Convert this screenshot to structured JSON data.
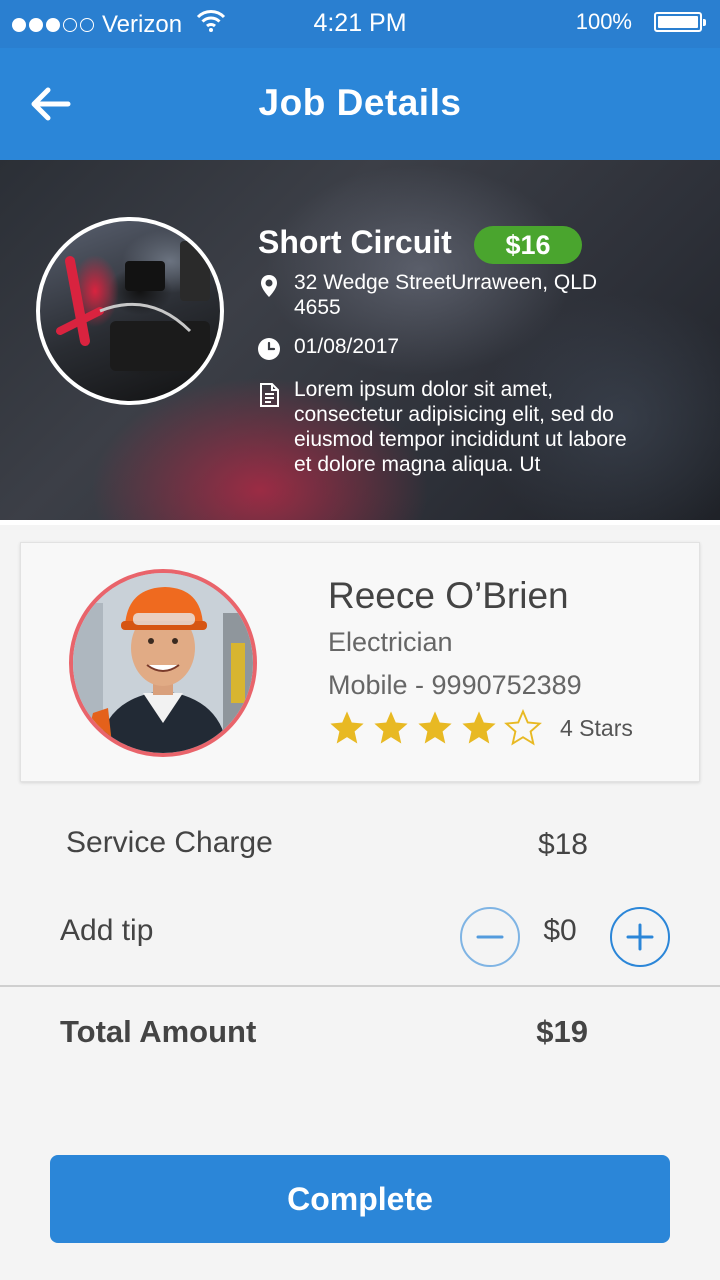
{
  "status_bar": {
    "carrier": "Verizon",
    "time": "4:21 PM",
    "battery": "100%",
    "signal_icon": "signal-dots-icon",
    "wifi_icon": "wifi-icon",
    "battery_icon": "battery-icon"
  },
  "app_bar": {
    "title": "Job Details",
    "back_icon": "arrow-left-icon"
  },
  "job": {
    "title": "Short Circuit",
    "price": "$16",
    "address": "32 Wedge StreetUrraween, QLD 4655",
    "date": "01/08/2017",
    "description": "Lorem ipsum dolor sit amet, consectetur adipisicing elit, sed do eiusmod tempor incididunt ut labore et dolore magna aliqua. Ut"
  },
  "worker": {
    "name": "Reece O’Brien",
    "role": "Electrician",
    "mobile": "Mobile - 9990752389",
    "rating": 4,
    "rating_max": 5,
    "rating_text": "4 Stars"
  },
  "charges": {
    "service_label": "Service Charge",
    "service_value": "$18",
    "tip_label": "Add tip",
    "tip_value": "$0",
    "total_label": "Total Amount",
    "total_value": "$19"
  },
  "actions": {
    "complete_label": "Complete"
  },
  "colors": {
    "primary": "#2b86d8",
    "price_badge": "#4aa52e",
    "star": "#e8b923",
    "worker_ring": "#e9646b"
  }
}
